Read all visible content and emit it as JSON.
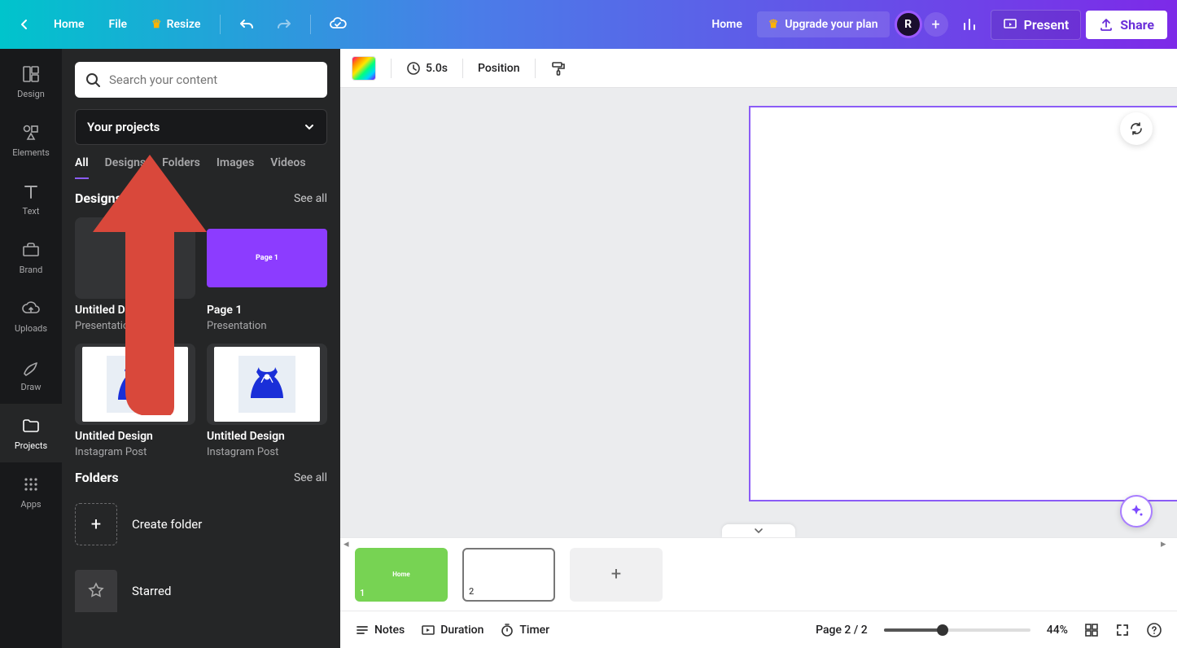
{
  "topbar": {
    "home": "Home",
    "file": "File",
    "resize": "Resize",
    "home_right": "Home",
    "upgrade": "Upgrade your plan",
    "avatar_letter": "R",
    "present": "Present",
    "share": "Share"
  },
  "narrow_sidebar": {
    "items": [
      "Design",
      "Elements",
      "Text",
      "Brand",
      "Uploads",
      "Draw",
      "Projects",
      "Apps"
    ],
    "active_index": 6
  },
  "panel": {
    "search_placeholder": "Search your content",
    "dropdown_label": "Your projects",
    "tabs": [
      "All",
      "Designs",
      "Folders",
      "Images",
      "Videos"
    ],
    "active_tab": 0,
    "designs_header": "Designs",
    "see_all": "See all",
    "designs": [
      {
        "title": "Untitled Design",
        "subtitle": "Presentation",
        "thumb_type": "gray"
      },
      {
        "title": "Page 1",
        "subtitle": "Presentation",
        "thumb_type": "purple",
        "thumb_text": "Page 1"
      },
      {
        "title": "Untitled Design",
        "subtitle": "Instagram Post",
        "thumb_type": "dress"
      },
      {
        "title": "Untitled Design",
        "subtitle": "Instagram Post",
        "thumb_type": "dress"
      }
    ],
    "folders_header": "Folders",
    "create_folder": "Create folder",
    "starred": "Starred"
  },
  "canvas_toolbar": {
    "duration": "5.0s",
    "position": "Position"
  },
  "page_strip": {
    "thumb1_text": "Home",
    "thumb1_num": "1",
    "thumb2_num": "2"
  },
  "bottom_bar": {
    "notes": "Notes",
    "duration": "Duration",
    "timer": "Timer",
    "page_indicator": "Page 2 / 2",
    "zoom": "44%"
  }
}
